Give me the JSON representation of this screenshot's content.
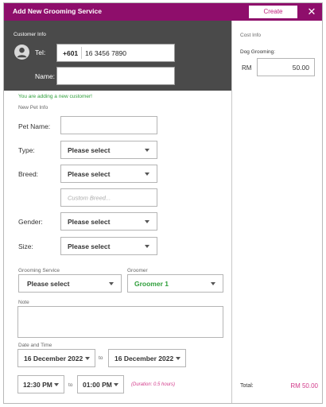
{
  "dialog": {
    "title": "Add New Grooming Service",
    "create_label": "Create",
    "close_glyph": "✕"
  },
  "customer": {
    "section_title": "Customer Info",
    "tel_label": "Tel:",
    "country_code": "+601",
    "tel_value": "16 3456 7890",
    "name_label": "Name:",
    "name_value": ""
  },
  "pet": {
    "new_customer_msg": "You are adding a new customer!",
    "section_title": "New Pet Info",
    "name_label": "Pet Name:",
    "name_value": "",
    "type_label": "Type:",
    "type_value": "Please select",
    "breed_label": "Breed:",
    "breed_value": "Please select",
    "custom_breed_placeholder": "Custom Breed...",
    "gender_label": "Gender:",
    "gender_value": "Please select",
    "size_label": "Size:",
    "size_value": "Please select"
  },
  "service": {
    "grooming_label": "Grooming Service",
    "grooming_value": "Please select",
    "groomer_label": "Groomer",
    "groomer_value": "Groomer 1",
    "groomer_color": "#2e9e3a",
    "note_label": "Note",
    "note_value": ""
  },
  "datetime": {
    "section_label": "Date and Time",
    "start_date": "16 December 2022",
    "end_date": "16 December 2022",
    "to_label": "to",
    "start_time": "12:30 PM",
    "end_time": "01:00 PM",
    "duration": "(Duration: 0.5 hours)"
  },
  "cost": {
    "section_title": "Cost Info",
    "item_label": "Dog Grooming:",
    "currency": "RM",
    "item_value": "50.00",
    "total_label": "Total:",
    "total_value": "RM 50.00"
  },
  "colors": {
    "brand": "#8e0e6b",
    "accent": "#d23a8a",
    "customer_panel": "#4a4a4a",
    "success": "#2e9e3a"
  },
  "icons": {
    "avatar": "user-avatar-icon",
    "close": "close-icon",
    "dropdown": "chevron-down-icon"
  }
}
